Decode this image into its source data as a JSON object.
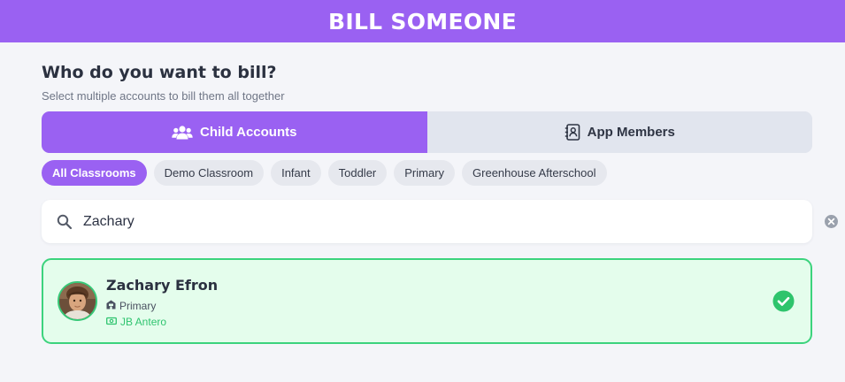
{
  "header": {
    "title": "BILL SOMEONE"
  },
  "prompt": {
    "question": "Who do you want to bill?",
    "subtitle": "Select multiple accounts to bill them all together"
  },
  "tabs": [
    {
      "label": "Child Accounts",
      "icon": "users-icon",
      "active": true
    },
    {
      "label": "App Members",
      "icon": "contact-card-icon",
      "active": false
    }
  ],
  "filters": [
    {
      "label": "All Classrooms",
      "active": true
    },
    {
      "label": "Demo Classroom",
      "active": false
    },
    {
      "label": "Infant",
      "active": false
    },
    {
      "label": "Toddler",
      "active": false
    },
    {
      "label": "Primary",
      "active": false
    },
    {
      "label": "Greenhouse Afterschool",
      "active": false
    }
  ],
  "search": {
    "value": "Zachary",
    "icon": "search-icon",
    "clear_icon": "clear-circle-icon"
  },
  "results": [
    {
      "name": "Zachary Efron",
      "classroom": "Primary",
      "account": "JB Antero",
      "selected": true
    }
  ],
  "colors": {
    "brand": "#9a61f2",
    "selected_border": "#3cd37d",
    "selected_bg": "#e4fdec",
    "account_text": "#2fc46f"
  }
}
